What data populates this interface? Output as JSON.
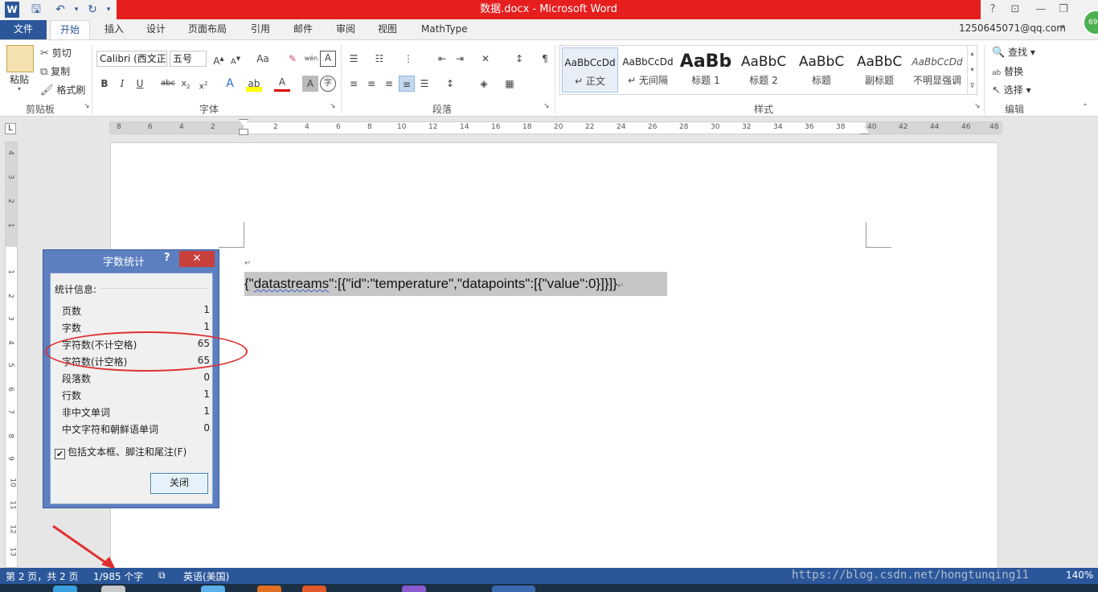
{
  "window": {
    "title": "数据.docx -  Microsoft Word",
    "help": "?",
    "account": "1250645071@qq.com",
    "avatar_badge": "69"
  },
  "tabs": [
    "文件",
    "开始",
    "插入",
    "设计",
    "页面布局",
    "引用",
    "邮件",
    "审阅",
    "视图",
    "MathType"
  ],
  "ribbon": {
    "clipboard": {
      "paste": "粘贴",
      "cut": "剪切",
      "copy": "复制",
      "format_painter": "格式刷",
      "label": "剪贴板"
    },
    "font": {
      "name": "Calibri (西文正",
      "size": "五号",
      "label": "字体",
      "change_case": "Aa",
      "phonetic": "wén"
    },
    "paragraph": {
      "label": "段落"
    },
    "styles": {
      "label": "样式",
      "items": [
        {
          "sample": "AaBbCcDd",
          "name": "↵ 正文"
        },
        {
          "sample": "AaBbCcDd",
          "name": "↵ 无间隔"
        },
        {
          "sample": "AaBb",
          "name": "标题 1"
        },
        {
          "sample": "AaBbC",
          "name": "标题 2"
        },
        {
          "sample": "AaBbC",
          "name": "标题"
        },
        {
          "sample": "AaBbC",
          "name": "副标题"
        },
        {
          "sample": "AaBbCcDd",
          "name": "不明显强调"
        }
      ]
    },
    "editing": {
      "find": "查找",
      "replace": "替换",
      "select": "选择",
      "label": "编辑"
    }
  },
  "ruler": {
    "corner": "L",
    "h_numbers": [
      "8",
      "6",
      "4",
      "2",
      "2",
      "4",
      "6",
      "8",
      "10",
      "12",
      "14",
      "16",
      "18",
      "20",
      "22",
      "24",
      "26",
      "28",
      "30",
      "32",
      "34",
      "36",
      "38",
      "40",
      "42",
      "44",
      "46",
      "48"
    ],
    "v_numbers": [
      "4",
      "3",
      "2",
      "1",
      "1",
      "1",
      "2",
      "3",
      "4",
      "5",
      "6",
      "7",
      "8",
      "9",
      "10",
      "11",
      "12",
      "13"
    ]
  },
  "document": {
    "para_mark": "↵",
    "json_prefix": "{\"",
    "json_word": "datastreams",
    "json_rest": "\":[{\"id\":\"temperature\",\"datapoints\":[{\"value\":0}]}]}",
    "end_mark": "↵"
  },
  "dialog": {
    "title": "字数统计",
    "help": "?",
    "close_x": "✕",
    "stats_label": "统计信息:",
    "rows": [
      {
        "label": "页数",
        "value": "1"
      },
      {
        "label": "字数",
        "value": "1"
      },
      {
        "label": "字符数(不计空格)",
        "value": "65"
      },
      {
        "label": "字符数(计空格)",
        "value": "65"
      },
      {
        "label": "段落数",
        "value": "0"
      },
      {
        "label": "行数",
        "value": "1"
      },
      {
        "label": "非中文单词",
        "value": "1"
      },
      {
        "label": "中文字符和朝鲜语单词",
        "value": "0"
      }
    ],
    "checkbox_label": "包括文本框、脚注和尾注(F)",
    "checkbox_checked": true,
    "close_button": "关闭"
  },
  "statusbar": {
    "page": "第 2 页，共 2 页",
    "words": "1/985 个字",
    "language": "英语(美国)",
    "zoom": "140%",
    "watermark": "https://blog.csdn.net/hongtunqing11"
  },
  "colors": {
    "accent": "#2b579a",
    "title_red": "#e61e1e",
    "annotation": "#e03030"
  }
}
